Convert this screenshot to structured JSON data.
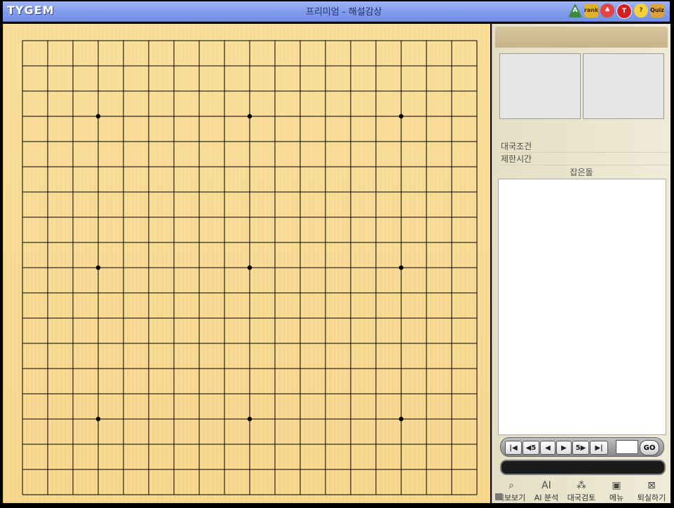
{
  "app": {
    "logo_text": "TYGEM",
    "title_center": "프리미엄 - 해설감상",
    "title_icons": [
      "a-icon",
      "rank-icon",
      "bird-icon",
      "t-icon",
      "help-icon",
      "quiz-icon"
    ]
  },
  "board": {
    "size": 19,
    "star_points": [
      [
        3,
        3
      ],
      [
        9,
        3
      ],
      [
        15,
        3
      ],
      [
        3,
        9
      ],
      [
        9,
        9
      ],
      [
        15,
        9
      ],
      [
        3,
        15
      ],
      [
        9,
        15
      ],
      [
        15,
        15
      ]
    ],
    "line_color": "#000000"
  },
  "panel": {
    "game_condition_label": "대국조건",
    "time_limit_label": "제한시간",
    "captured_stones_label": "잡은돌",
    "navigation": {
      "first": "|◀",
      "back5": "◀5",
      "prev": "◀",
      "next": "▶",
      "fwd5": "5▶",
      "last": "▶|",
      "go_label": "GO",
      "move_input_value": ""
    },
    "bottom_menu": [
      {
        "icon": "search-icon",
        "label": "기보보기"
      },
      {
        "icon": "ai-icon",
        "label": "AI\n분석"
      },
      {
        "icon": "stones-icon",
        "label": "대국검토"
      },
      {
        "icon": "book-icon",
        "label": "메뉴"
      },
      {
        "icon": "exit-icon",
        "label": "퇴실하기"
      }
    ]
  },
  "colors": {
    "titlebar": "#7f9bec",
    "board": "#f7d78f",
    "panel": "#ebe7d2"
  }
}
